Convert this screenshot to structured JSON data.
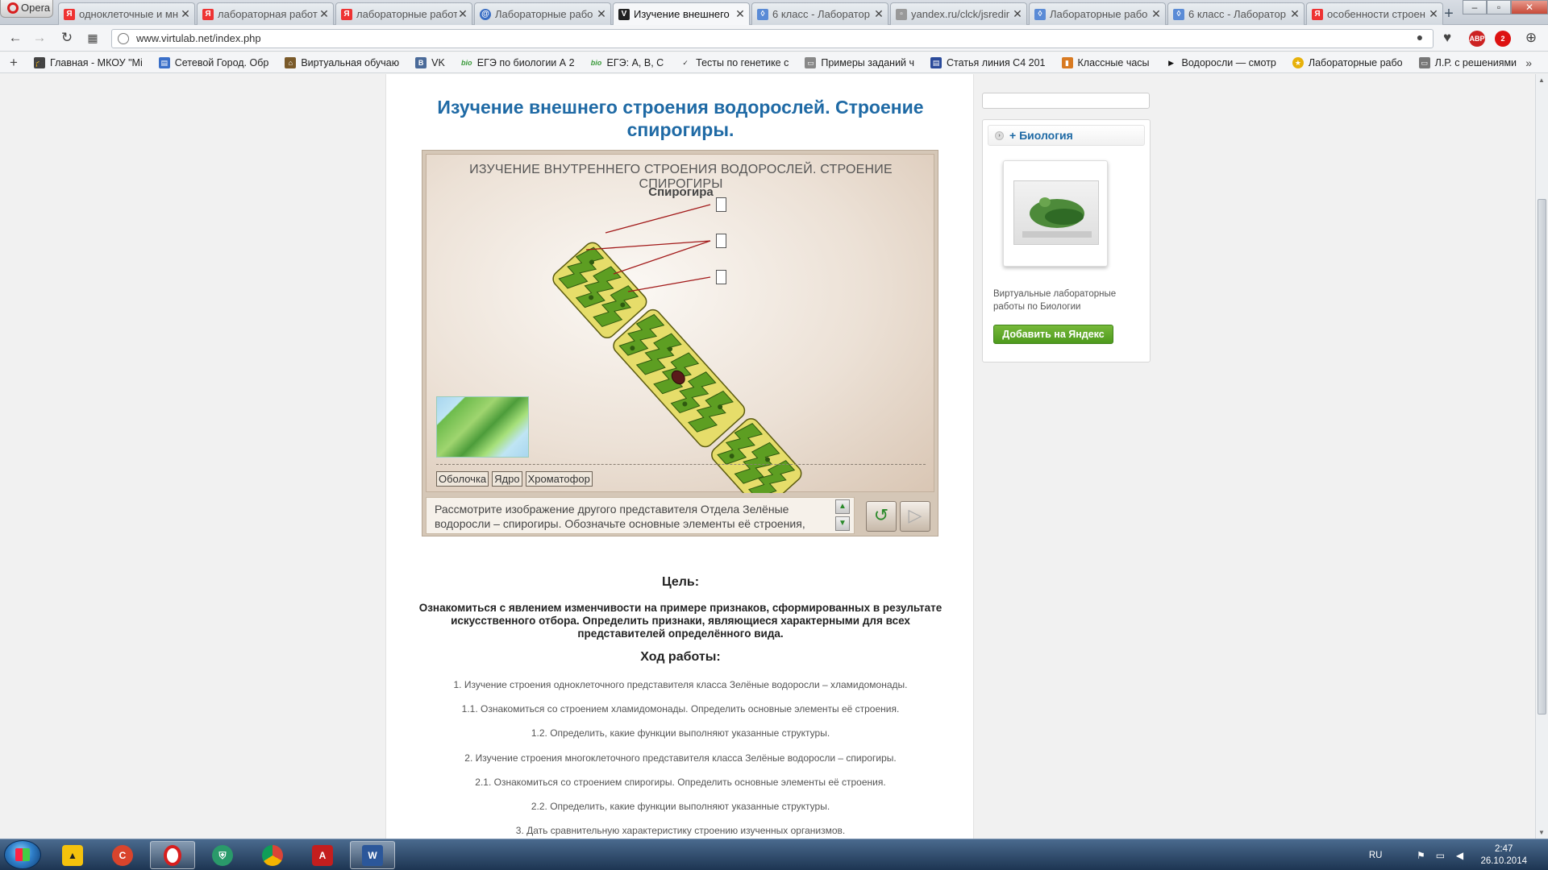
{
  "browser": {
    "menu_label": "Opera",
    "tabs": [
      {
        "title": "одноклеточные и мн",
        "icon": "yandex-icon"
      },
      {
        "title": "лабораторная работ",
        "icon": "yandex-icon"
      },
      {
        "title": "лабораторные работ",
        "icon": "yandex-icon"
      },
      {
        "title": "Лабораторные рабо",
        "icon": "virtulab-icon"
      },
      {
        "title": "Изучение внешнего",
        "icon": "virtulab-v-icon"
      },
      {
        "title": "6 класс - Лаборатор",
        "icon": "virtulab-icon"
      },
      {
        "title": "yandex.ru/clck/jsredir",
        "icon": "page-icon"
      },
      {
        "title": "Лабораторные рабо",
        "icon": "virtulab-icon"
      },
      {
        "title": "6 класс - Лаборатор",
        "icon": "virtulab-icon"
      },
      {
        "title": "особенности строен",
        "icon": "yandex-icon"
      }
    ],
    "active_tab_index": 4,
    "url": "www.virtulab.net/index.php",
    "bookmarks": [
      {
        "label": "Главная - МКОУ \"Мі",
        "icon": "grad-cap-icon"
      },
      {
        "label": "Сетевой Город. Обр",
        "icon": "city-icon"
      },
      {
        "label": "Виртуальная обучаю",
        "icon": "school-icon"
      },
      {
        "label": "VK",
        "icon": "vk-icon"
      },
      {
        "label": "ЕГЭ по биологии А 2",
        "icon": "bio-icon"
      },
      {
        "label": "ЕГЭ: А, В, С",
        "icon": "bio-icon"
      },
      {
        "label": "Тесты по генетике с",
        "icon": "check-icon"
      },
      {
        "label": "Примеры заданий ч",
        "icon": "doc-icon"
      },
      {
        "label": "Статья линия С4 201",
        "icon": "article-icon"
      },
      {
        "label": "Классные часы",
        "icon": "bookmark-icon"
      },
      {
        "label": "Водоросли — смотр",
        "icon": "play-icon"
      },
      {
        "label": "Лабораторные рабо",
        "icon": "star-icon"
      },
      {
        "label": "Л.Р. с решениями",
        "icon": "doc-icon"
      }
    ],
    "ext_badges": {
      "abp": "ABP",
      "abp_count": "2",
      "red_count": "2"
    }
  },
  "page": {
    "title": "Изучение внешнего строения водорослей. Строение спирогиры.",
    "lab": {
      "heading": "ИЗУЧЕНИЕ ВНУТРЕННЕГО СТРОЕНИЯ ВОДОРОСЛЕЙ. СТРОЕНИЕ СПИРОГИРЫ",
      "subheading": "Спирогира",
      "labels": [
        "Оболочка",
        "Ядро",
        "Хроматофор"
      ],
      "instruction": "Рассмотрите изображение другого представителя Отдела Зелёные водоросли – спирогиры. Обозначьте основные элементы её строения,"
    },
    "goal_title": "Цель:",
    "goal_text": "Ознакомиться с явлением изменчивости на примере признаков, сформированных в результате искусственного отбора. Определить признаки, являющиеся характерными для всех представителей определённого вида.",
    "steps_title": "Ход работы:",
    "steps": [
      "1. Изучение строения одноклеточного представителя класса Зелёные водоросли – хламидомонады.",
      "1.1. Ознакомиться со строением хламидомонады. Определить основные элементы её строения.",
      "1.2. Определить, какие функции выполняют указанные структуры.",
      "2. Изучение строения многоклеточного представителя класса Зелёные водоросли – спирогиры.",
      "2.1. Ознакомиться со строением спирогиры. Определить основные элементы её строения.",
      "2.2. Определить, какие функции выполняют указанные структуры.",
      "3. Дать сравнительную характеристику строению изученных организмов."
    ]
  },
  "sidebar": {
    "category": "+ Биология",
    "card_description": "Виртуальные лабораторные работы по Биологии",
    "add_button": "Добавить на Яндекс"
  },
  "taskbar": {
    "apps": [
      "aimp",
      "cleaner",
      "opera",
      "shield",
      "chrome",
      "acrobat",
      "word"
    ],
    "active_app": "opera",
    "language": "RU",
    "time": "2:47",
    "date": "26.10.2014"
  }
}
